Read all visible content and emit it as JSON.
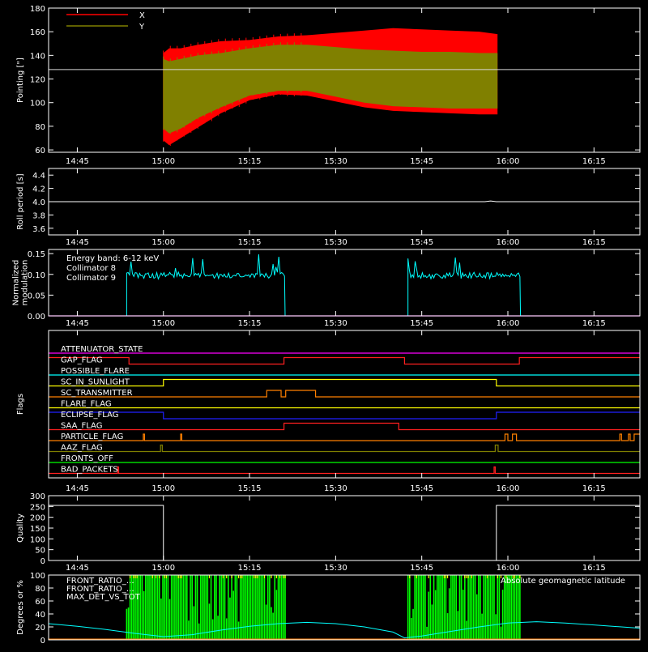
{
  "time_axis": {
    "ticks": [
      "14:45",
      "15:00",
      "15:15",
      "15:30",
      "15:45",
      "16:00",
      "16:15"
    ],
    "tick_minutes": [
      885,
      900,
      915,
      930,
      945,
      960,
      975
    ],
    "range_minutes": [
      880,
      983
    ]
  },
  "colors": {
    "frame": "#ffffff",
    "x": "#ff0000",
    "y": "#808000",
    "ref": "#d8d8d8",
    "cyan": "#00ffff",
    "magenta": "#ff00ff",
    "green": "#00ff00",
    "yellow": "#ffff00",
    "orange": "#ff8000",
    "red": "#ff2020",
    "blue": "#2020ff"
  },
  "chart_data": [
    {
      "id": "pointing",
      "type": "area",
      "ylabel": "Pointing [\"]",
      "ylim": [
        58,
        180
      ],
      "yticks": [
        60,
        80,
        100,
        120,
        140,
        160,
        180
      ],
      "reference_line_y": 128,
      "series": [
        {
          "name": "X",
          "x": [
            900,
            901,
            903,
            906,
            910,
            915,
            920,
            925,
            930,
            935,
            940,
            945,
            950,
            955,
            958.2,
            958.2
          ],
          "upper": [
            142,
            146,
            146,
            149,
            152,
            153,
            156,
            157,
            159,
            161,
            163,
            162,
            161,
            160,
            158,
            170
          ],
          "lower": [
            68,
            64,
            70,
            79,
            91,
            102,
            107,
            106,
            101,
            96,
            93,
            92,
            91,
            90,
            90,
            80
          ]
        },
        {
          "name": "Y",
          "x": [
            900,
            901,
            903,
            906,
            910,
            915,
            920,
            925,
            930,
            935,
            940,
            945,
            950,
            955,
            958.2
          ],
          "upper": [
            137,
            135,
            137,
            140,
            142,
            146,
            149,
            149,
            147,
            145,
            144,
            143,
            143,
            142,
            142
          ],
          "lower": [
            78,
            74,
            78,
            87,
            96,
            106,
            110,
            110,
            105,
            100,
            97,
            96,
            95,
            95,
            95
          ]
        }
      ]
    },
    {
      "id": "roll",
      "type": "line",
      "ylabel": "Roll period [s]",
      "ylim": [
        3.5,
        4.5
      ],
      "yticks": [
        3.6,
        3.8,
        4.0,
        4.2,
        4.4
      ],
      "series": [
        {
          "name": "",
          "x": [
            880,
            956,
            957,
            958,
            983
          ],
          "y": [
            4.0,
            4.0,
            4.01,
            4.0,
            4.0
          ]
        }
      ]
    },
    {
      "id": "modulation",
      "type": "line",
      "ylabel": "Normalized modulation",
      "ylim": [
        0,
        0.16
      ],
      "yticks": [
        0.0,
        0.05,
        0.1,
        0.15
      ],
      "annotation": "Energy band: 6-12 keV",
      "series": [
        {
          "name": "Collimator 8",
          "color": "#00ffff",
          "segments": [
            [
              893.6,
              921.2
            ],
            [
              942.6,
              962.2
            ]
          ],
          "base": 0.09,
          "spread": [
            0.085,
            0.15
          ]
        },
        {
          "name": "Collimator 9",
          "color": "#ff00ff",
          "flat": 0.0
        }
      ]
    },
    {
      "id": "flags",
      "type": "line",
      "ylabel": "Flags",
      "flags": [
        {
          "name": "ATTENUATOR_STATE",
          "color": "#ff00ff",
          "steps": [
            [
              880,
              0
            ],
            [
              983,
              0
            ]
          ]
        },
        {
          "name": "GAP_FLAG",
          "color": "#ff2020",
          "steps": [
            [
              880,
              1
            ],
            [
              894,
              0
            ],
            [
              921,
              1
            ],
            [
              942,
              0
            ],
            [
              962,
              1
            ],
            [
              983,
              1
            ]
          ]
        },
        {
          "name": "POSSIBLE_FLARE",
          "color": "#00ffff",
          "steps": [
            [
              880,
              0
            ],
            [
              983,
              0
            ]
          ]
        },
        {
          "name": "SC_IN_SUNLIGHT",
          "color": "#ffff00",
          "steps": [
            [
              880,
              0
            ],
            [
              900,
              1
            ],
            [
              958,
              0
            ],
            [
              983,
              0
            ]
          ]
        },
        {
          "name": "SC_TRANSMITTER",
          "color": "#ff8000",
          "steps": [
            [
              880,
              0
            ],
            [
              918,
              1
            ],
            [
              920.5,
              0
            ],
            [
              921.3,
              1
            ],
            [
              926.5,
              0
            ],
            [
              983,
              0
            ]
          ]
        },
        {
          "name": "FLARE_FLAG",
          "color": "#ffff00",
          "steps": [
            [
              880,
              0
            ],
            [
              983,
              0
            ]
          ]
        },
        {
          "name": "ECLIPSE_FLAG",
          "color": "#2020ff",
          "steps": [
            [
              880,
              1
            ],
            [
              900,
              0
            ],
            [
              958,
              1
            ],
            [
              983,
              1
            ]
          ]
        },
        {
          "name": "SAA_FLAG",
          "color": "#ff2020",
          "steps": [
            [
              880,
              0
            ],
            [
              921,
              1
            ],
            [
              941,
              0
            ],
            [
              983,
              0
            ]
          ]
        },
        {
          "name": "PARTICLE_FLAG",
          "color": "#ff8000",
          "steps": [
            [
              880,
              0
            ],
            [
              896.5,
              1
            ],
            [
              896.7,
              0
            ],
            [
              903,
              1
            ],
            [
              903.2,
              0
            ],
            [
              959.5,
              1
            ],
            [
              960,
              0
            ],
            [
              960.8,
              1
            ],
            [
              961.5,
              0
            ],
            [
              979.5,
              1
            ],
            [
              979.8,
              0
            ],
            [
              981,
              1
            ],
            [
              981.3,
              0
            ],
            [
              982,
              1
            ],
            [
              983,
              1
            ]
          ]
        },
        {
          "name": "AAZ_FLAG",
          "color": "#808000",
          "steps": [
            [
              880,
              0
            ],
            [
              899.5,
              1
            ],
            [
              899.8,
              0
            ],
            [
              957.8,
              1
            ],
            [
              958.3,
              0
            ],
            [
              983,
              0
            ]
          ]
        },
        {
          "name": "FRONTS_OFF",
          "color": "#00ff00",
          "steps": [
            [
              880,
              0
            ],
            [
              983,
              0
            ]
          ]
        },
        {
          "name": "BAD_PACKETS",
          "color": "#ff2020",
          "steps": [
            [
              880,
              0
            ],
            [
              892,
              1
            ],
            [
              892.2,
              0
            ],
            [
              957.6,
              1
            ],
            [
              957.8,
              0
            ],
            [
              983,
              0
            ]
          ]
        }
      ]
    },
    {
      "id": "quality",
      "type": "line",
      "ylabel": "Quality",
      "ylim": [
        0,
        300
      ],
      "yticks": [
        0,
        50,
        100,
        150,
        200,
        250,
        300
      ],
      "series": [
        {
          "name": "",
          "x": [
            880,
            900,
            900,
            958,
            958,
            983
          ],
          "y": [
            255,
            255,
            0,
            0,
            255,
            255
          ]
        }
      ]
    },
    {
      "id": "ratios",
      "type": "area",
      "ylabel": "Degrees or %",
      "ylim": [
        0,
        100
      ],
      "yticks": [
        0,
        20,
        40,
        60,
        80,
        100
      ],
      "legend": [
        "FRONT_RATIO_…",
        "FRONT_RATIO_…",
        "MAX_DET_VS_TOT"
      ],
      "legend_colors": [
        "#ffff00",
        "#00ff00",
        "#ff8000"
      ],
      "latitude_label": "Absolute geomagnetic latitude",
      "blocks": [
        [
          893.6,
          921.2
        ],
        [
          942.6,
          962.2
        ]
      ],
      "latitude": {
        "x": [
          880,
          885,
          890,
          895,
          900,
          905,
          910,
          915,
          920,
          925,
          930,
          935,
          940,
          942,
          945,
          950,
          955,
          960,
          965,
          970,
          975,
          983
        ],
        "y": [
          25,
          21,
          16,
          10,
          5,
          8,
          15,
          21,
          25,
          27,
          25,
          20,
          12,
          3,
          6,
          13,
          20,
          26,
          28,
          26,
          23,
          18
        ]
      }
    }
  ]
}
